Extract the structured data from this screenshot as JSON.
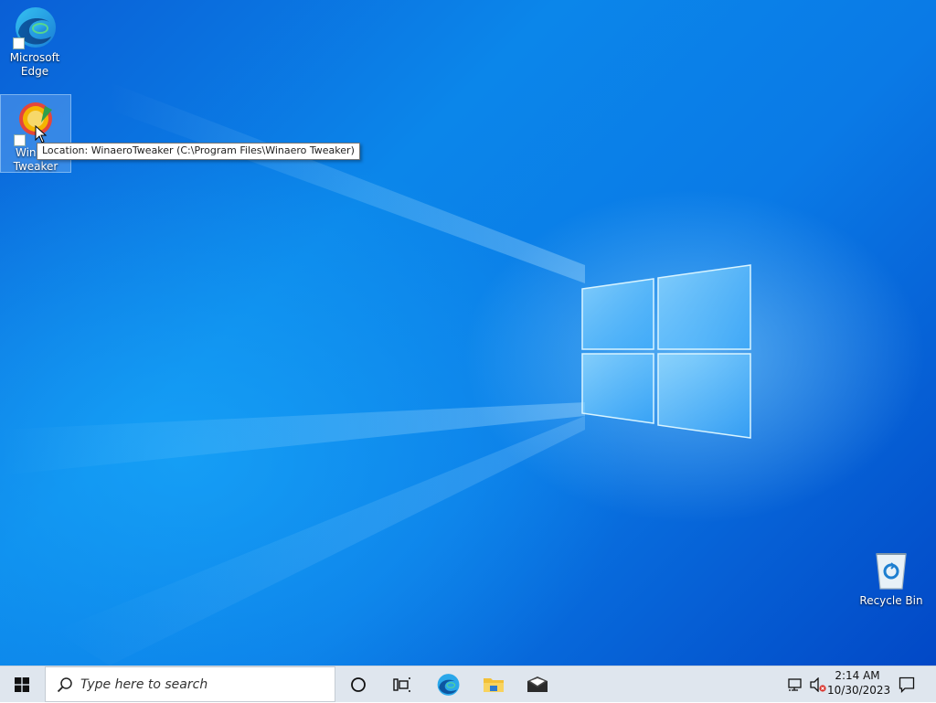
{
  "desktop": {
    "icons": [
      {
        "label_line1": "Microsoft",
        "label_line2": "Edge",
        "icon": "edge-icon"
      },
      {
        "label_line1": "Win",
        "label_line2": "Tweaker",
        "icon": "winaero-tweaker-icon",
        "selected": true
      },
      {
        "label_line1": "Recycle Bin",
        "label_line2": "",
        "icon": "recycle-bin-icon"
      }
    ],
    "tooltip": "Location: WinaeroTweaker (C:\\Program Files\\Winaero Tweaker)",
    "wallpaper_colors": {
      "dark": "#0248c6",
      "mid": "#0b86ea",
      "light": "#7fd4ff"
    }
  },
  "taskbar": {
    "start_icon": "windows-start-icon",
    "search_placeholder": "Type here to search",
    "pinned": [
      "cortana-icon",
      "task-view-icon",
      "edge-icon",
      "file-explorer-icon",
      "mail-icon"
    ],
    "tray": {
      "icons": [
        "network-icon",
        "volume-muted-icon"
      ],
      "time": "2:14 AM",
      "date": "10/30/2023",
      "notification_icon": "action-center-icon"
    },
    "background": "#dfe6ee"
  }
}
